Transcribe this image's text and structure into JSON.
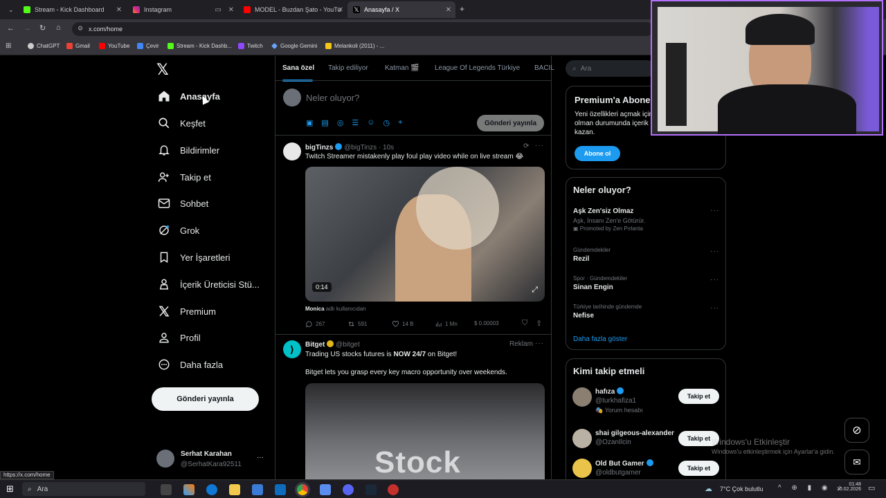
{
  "browser": {
    "tabs": [
      {
        "title": "Stream - Kick Dashboard",
        "active": false
      },
      {
        "title": "Instagram",
        "active": false
      },
      {
        "title": "MODEL - Buzdan Şato - YouTu",
        "active": false
      },
      {
        "title": "Anasayfa / X",
        "active": true
      }
    ],
    "url": "x.com/home",
    "bookmarks": [
      "ChatGPT",
      "Gmail",
      "YouTube",
      "Çevir",
      "Stream - Kick Dashb...",
      "Twitch",
      "Google Gemini",
      "Melankoli (2011) - ..."
    ],
    "status_url": "https://x.com/home"
  },
  "nav": {
    "items": [
      {
        "label": "Anasayfa",
        "icon": "home-icon"
      },
      {
        "label": "Keşfet",
        "icon": "search-icon"
      },
      {
        "label": "Bildirimler",
        "icon": "bell-icon"
      },
      {
        "label": "Takip et",
        "icon": "person-plus-icon"
      },
      {
        "label": "Sohbet",
        "icon": "mail-icon"
      },
      {
        "label": "Grok",
        "icon": "grok-icon"
      },
      {
        "label": "Yer İşaretleri",
        "icon": "bookmark-icon"
      },
      {
        "label": "İçerik Üreticisi Stü...",
        "icon": "creator-studio-icon"
      },
      {
        "label": "Premium",
        "icon": "x-logo-icon"
      },
      {
        "label": "Profil",
        "icon": "profile-icon"
      },
      {
        "label": "Daha fazla",
        "icon": "more-circle-icon"
      }
    ],
    "post_button": "Gönderi yayınla",
    "account": {
      "name": "Serhat Karahan",
      "handle": "@SerhatKara92511"
    }
  },
  "timeline": {
    "tabs": [
      "Sana özel",
      "Takip ediliyor",
      "Katman",
      "League Of Legends Türkiye",
      "BACIL"
    ],
    "composer": {
      "placeholder": "Neler oluyor?",
      "button": "Gönderi yayınla"
    },
    "posts": [
      {
        "name": "bigTinzs",
        "handle": "@bigTinzs · 10s",
        "text": "Twitch Streamer mistakenly play foul play video while on live stream 😂",
        "video_time": "0:14",
        "caption_name": "Monica",
        "caption_rest": "adlı kullanıcıdan",
        "stats": {
          "replies": "267",
          "reposts": "591",
          "likes": "14 B",
          "views": "1 Mn",
          "tips": "$ 0.00003"
        }
      },
      {
        "name": "Bitget",
        "handle": "@bitget",
        "ad_label": "Reklam",
        "text_pre": "Trading US stocks futures is ",
        "text_bold": "NOW 24/7",
        "text_post": " on Bitget!",
        "text2": "Bitget lets you grasp every key macro opportunity over weekends.",
        "image_text": "Stock"
      }
    ]
  },
  "sidebar": {
    "search_placeholder": "Ara",
    "premium": {
      "title": "Premium'a Abone",
      "body_l1": "Yeni özellikleri açmak için a",
      "body_l2": "olman durumunda içerik ü",
      "body_l3": "kazan.",
      "button": "Abone ol"
    },
    "trends": {
      "title": "Neler oluyor?",
      "items": [
        {
          "category": "",
          "name": "Aşk Zen'siz Olmaz",
          "sub": "Aşk, İnsanı Zen'e Götürür.",
          "promo": "Promoted by Zen Pırlanta"
        },
        {
          "category": "Gündemdekiler",
          "name": "Rezil"
        },
        {
          "category": "Spor · Gündemdekiler",
          "name": "Sinan Engin"
        },
        {
          "category": "Türkiye tarihinde gündemde",
          "name": "Nefise"
        }
      ],
      "show_more": "Daha fazla göster"
    },
    "who_to_follow": {
      "title": "Kimi takip etmeli",
      "users": [
        {
          "name": "hafıza",
          "handle": "@turkhafiza1",
          "sub": "Yorum hesabı",
          "button": "Takip et"
        },
        {
          "name": "shai gilgeous-alexander",
          "handle": "@OzanIlcin",
          "button": "Takip et"
        },
        {
          "name": "Old But Gamer",
          "handle": "@oldbutgamer",
          "button": "Takip et"
        }
      ]
    }
  },
  "watermark": {
    "line1": "Windows'u Etkinleştir",
    "line2": "Windows'u etkinleştirmek için Ayarlar'a gidin."
  },
  "taskbar": {
    "search": "Ara",
    "weather": "7°C  Çok bulutlu",
    "time": "01:48",
    "date": "10.02.2026"
  }
}
